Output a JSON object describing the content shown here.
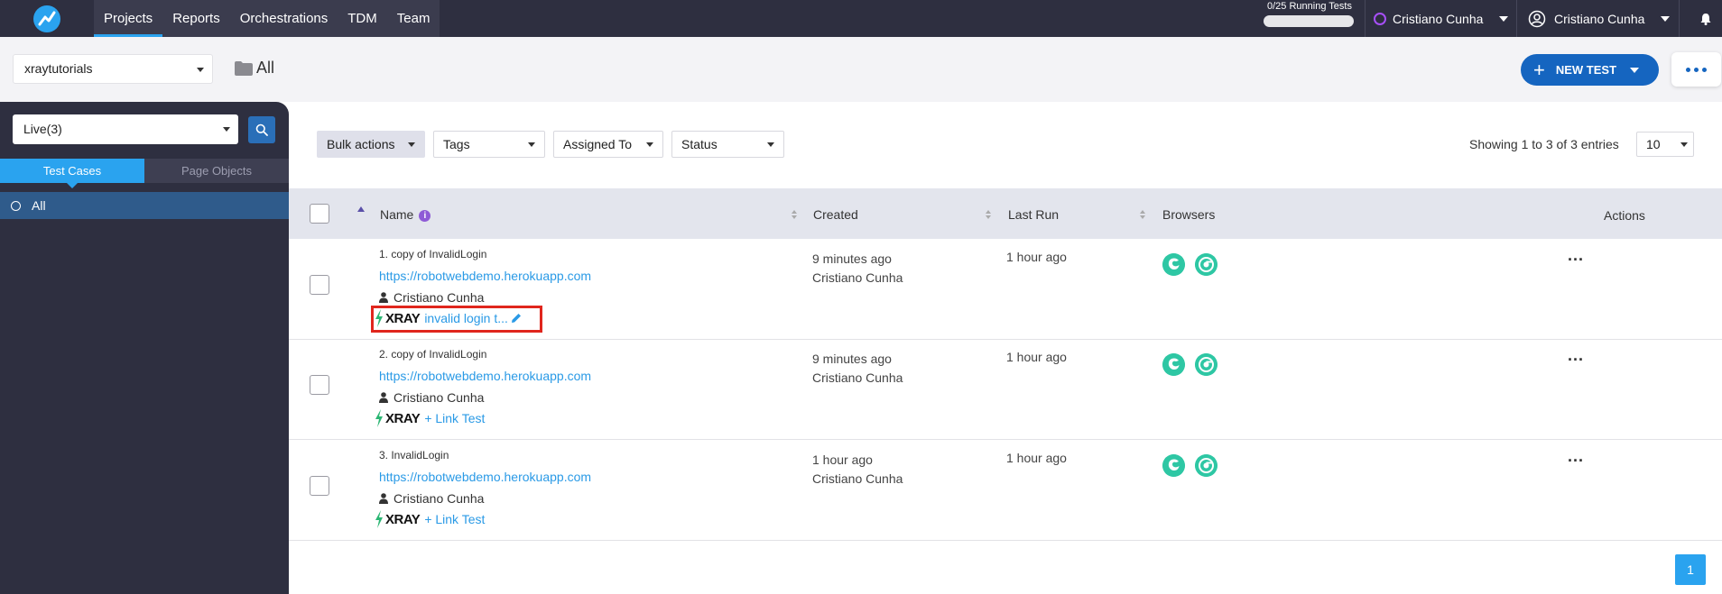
{
  "topnav": {
    "tabs": [
      "Projects",
      "Reports",
      "Orchestrations",
      "TDM",
      "Team"
    ],
    "running_tests": "0/25 Running Tests",
    "org_user": "Cristiano Cunha",
    "account_user": "Cristiano Cunha"
  },
  "subheader": {
    "project": "xraytutorials",
    "folder": "All",
    "new_test_label": "NEW TEST"
  },
  "sidebar": {
    "live_select": "Live(3)",
    "tabs": [
      "Test Cases",
      "Page Objects"
    ],
    "tree_root": "All"
  },
  "filters": {
    "bulk": "Bulk actions",
    "tags": "Tags",
    "assigned": "Assigned To",
    "status": "Status",
    "showing": "Showing 1 to 3 of 3 entries",
    "page_size": "10"
  },
  "table": {
    "headers": {
      "name": "Name",
      "created": "Created",
      "last_run": "Last Run",
      "browsers": "Browsers",
      "actions": "Actions"
    },
    "rows": [
      {
        "name": "1. copy of InvalidLogin",
        "url": "https://robotwebdemo.herokuapp.com",
        "author": "Cristiano Cunha",
        "xray": "XRAY",
        "xray_link": "invalid login t...",
        "created": "9 minutes ago",
        "created_by": "Cristiano Cunha",
        "last_run": "1 hour ago",
        "actions": "..."
      },
      {
        "name": "2. copy of InvalidLogin",
        "url": "https://robotwebdemo.herokuapp.com",
        "author": "Cristiano Cunha",
        "xray": "XRAY",
        "xray_link": "+ Link Test",
        "created": "9 minutes ago",
        "created_by": "Cristiano Cunha",
        "last_run": "1 hour ago",
        "actions": "..."
      },
      {
        "name": "3. InvalidLogin",
        "url": "https://robotwebdemo.herokuapp.com",
        "author": "Cristiano Cunha",
        "xray": "XRAY",
        "xray_link": "+ Link Test",
        "created": "1 hour ago",
        "created_by": "Cristiano Cunha",
        "last_run": "1 hour ago",
        "actions": "..."
      }
    ]
  },
  "pager": {
    "page": "1"
  },
  "icons": {
    "logo": "app-logo-icon",
    "folder": "folder-icon",
    "search": "search-icon",
    "bell": "bell-icon",
    "user": "user-circle-icon",
    "author": "person-icon",
    "xray": "xray-bolt-icon",
    "edit": "pencil-icon",
    "browsers": [
      "firefox-icon",
      "chrome-icon"
    ]
  },
  "colors": {
    "nav_bg": "#2e2f40",
    "accent": "#2aa3ef",
    "primary_button": "#1565c0",
    "highlight_box": "#e0261d",
    "browser_icon": "#2ec7a4"
  }
}
